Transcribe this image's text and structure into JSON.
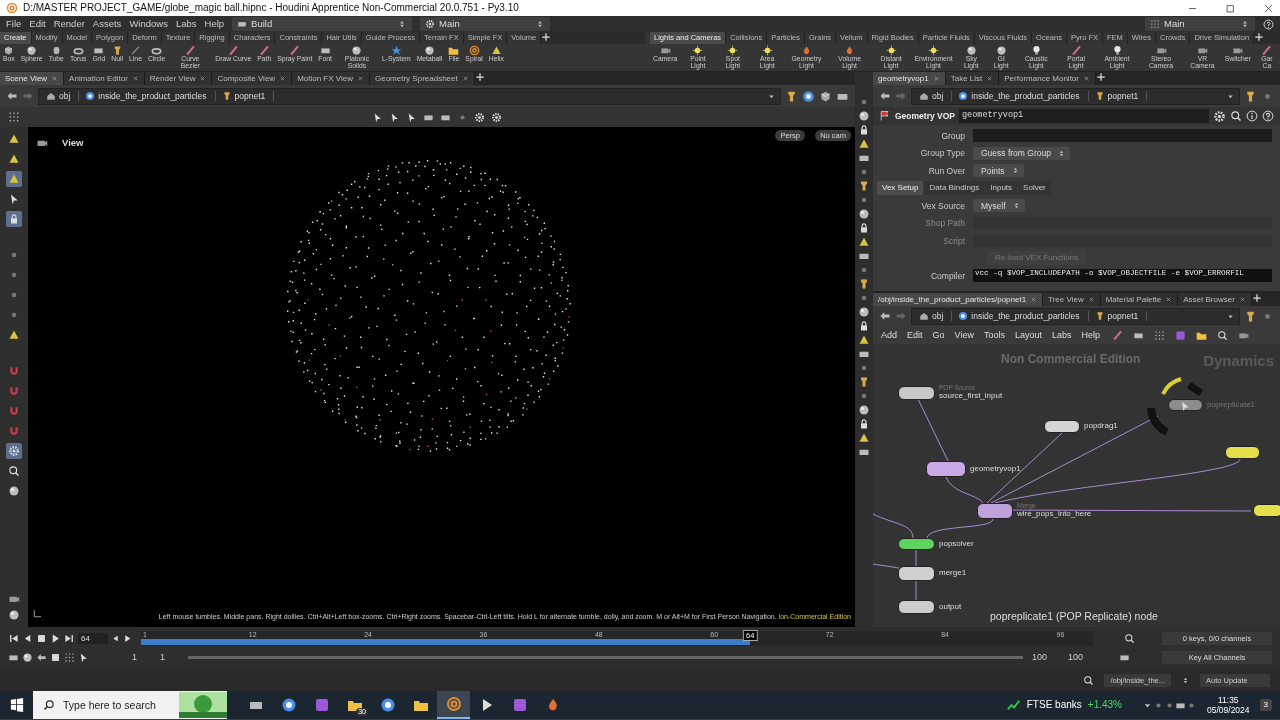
{
  "window": {
    "title": "D:/MASTER PROJECT_GAME/globe_magic ball.hipnc - Houdini Apprentice Non-Commercial 20.0.751 - Py3.10"
  },
  "menu_bar": {
    "items": [
      "File",
      "Edit",
      "Render",
      "Assets",
      "Windows",
      "Labs",
      "Help"
    ],
    "desktop": "Build",
    "context": "Main",
    "right_context": "Main"
  },
  "shelf_left": {
    "tabs": [
      {
        "label": "Create",
        "selected": true
      },
      {
        "label": "Modify",
        "selected": false
      },
      {
        "label": "Model",
        "selected": false
      },
      {
        "label": "Polygon",
        "selected": false
      },
      {
        "label": "Deform",
        "selected": false
      },
      {
        "label": "Texture",
        "selected": false
      },
      {
        "label": "Rigging",
        "selected": false
      },
      {
        "label": "Characters",
        "selected": false
      },
      {
        "label": "Constraints",
        "selected": false
      },
      {
        "label": "Hair Utils",
        "selected": false
      },
      {
        "label": "Guide Process",
        "selected": false
      },
      {
        "label": "Terrain FX",
        "selected": false
      },
      {
        "label": "Simple FX",
        "selected": false
      },
      {
        "label": "Volume",
        "selected": false
      }
    ],
    "tools": [
      "Box",
      "Sphere",
      "Tube",
      "Torus",
      "Grid",
      "Null",
      "Line",
      "Circle",
      "Curve Bezier",
      "Draw Curve",
      "Path",
      "Spray Paint",
      "Font",
      "Platonic Solids",
      "L-System",
      "Metaball",
      "File",
      "Spiral",
      "Helix"
    ]
  },
  "shelf_right": {
    "tabs": [
      {
        "label": "Lights and Cameras",
        "selected": true
      },
      {
        "label": "Collisions",
        "selected": false
      },
      {
        "label": "Particles",
        "selected": false
      },
      {
        "label": "Grains",
        "selected": false
      },
      {
        "label": "Vellum",
        "selected": false
      },
      {
        "label": "Rigid Bodies",
        "selected": false
      },
      {
        "label": "Particle Fluids",
        "selected": false
      },
      {
        "label": "Viscous Fluids",
        "selected": false
      },
      {
        "label": "Oceans",
        "selected": false
      },
      {
        "label": "Pyro FX",
        "selected": false
      },
      {
        "label": "FEM",
        "selected": false
      },
      {
        "label": "Wires",
        "selected": false
      },
      {
        "label": "Crowds",
        "selected": false
      },
      {
        "label": "Drive Simulation",
        "selected": false
      }
    ],
    "tools": [
      "Camera",
      "Point Light",
      "Spot Light",
      "Area Light",
      "Geometry Light",
      "Volume Light",
      "Distant Light",
      "Environment Light",
      "Sky Light",
      "GI Light",
      "Caustic Light",
      "Portal Light",
      "Ambient Light",
      "Stereo Camera",
      "VR Camera",
      "Switcher",
      "Gar Ca"
    ]
  },
  "scene_pane": {
    "tabs": [
      {
        "label": "Scene View",
        "selected": true
      },
      {
        "label": "Animation Editor",
        "selected": false
      },
      {
        "label": "Render View",
        "selected": false
      },
      {
        "label": "Composite View",
        "selected": false
      },
      {
        "label": "Motion FX View",
        "selected": false
      },
      {
        "label": "Geometry Spreadsheet",
        "selected": false
      }
    ],
    "path": [
      "obj",
      "inside_the_product_particles",
      "popnet1"
    ],
    "viewport_tools": [
      {
        "active": false
      },
      {
        "active": false
      },
      {
        "active": true
      },
      {
        "active": false
      },
      {
        "active": true
      },
      {
        "active": false
      },
      {
        "active": false
      },
      {
        "active": false
      },
      {
        "active": false
      },
      {
        "active": false
      },
      {
        "active": false
      },
      {
        "active": false
      },
      {
        "active": false
      },
      {
        "active": false
      },
      {
        "active": true
      },
      {
        "active": false
      },
      {
        "active": false
      }
    ],
    "viewport": {
      "label": "View",
      "view_menu": "Persp",
      "camera_menu": "No cam",
      "hint": "Left mouse tumbles. Middle pans. Right dollies. Ctrl+Alt+Left box-zooms. Ctrl+Right zooms. Spacebar-Ctrl-Left tilts. Hold L for alternate tumble, dolly, and zoom. M or Alt+M for First Person Navigation.",
      "edition": "ion-Commercial Edition"
    }
  },
  "parameter_pane": {
    "tabs": [
      {
        "label": "geometryvop1",
        "selected": true
      },
      {
        "label": "Take List",
        "selected": false
      },
      {
        "label": "Performance Monitor",
        "selected": false
      }
    ],
    "path": [
      "obj",
      "inside_the_product_particles",
      "popnet1"
    ],
    "node_type": "Geometry VOP",
    "node_name": "geometryvop1",
    "rows": [
      {
        "kind": "field",
        "label": "Group",
        "disabled": false
      },
      {
        "kind": "menu",
        "label": "Group Type",
        "value": "Guess from Group",
        "disabled": false
      },
      {
        "kind": "menu",
        "label": "Run Over",
        "value": "Points",
        "disabled": false
      },
      {
        "kind": "tabs",
        "tabs": [
          {
            "label": "Vex Setup",
            "selected": true
          },
          {
            "label": "Data Bindings",
            "selected": false
          },
          {
            "label": "Inputs",
            "selected": false
          },
          {
            "label": "Solver",
            "selected": false
          }
        ]
      },
      {
        "kind": "menu",
        "label": "Vex Source",
        "value": "Myself",
        "disabled": false
      },
      {
        "kind": "field",
        "label": "Shop Path",
        "disabled": true
      },
      {
        "kind": "field",
        "label": "Script",
        "disabled": true
      },
      {
        "kind": "button",
        "label": "Re-load VEX Functions",
        "disabled": true
      },
      {
        "kind": "field",
        "label": "Compiler",
        "value": "vcc -q $VOP_INCLUDEPATH -o $VOP_OBJECTFILE -e $VOP_ERRORFIL",
        "disabled": false
      }
    ]
  },
  "network_pane": {
    "tabs": [
      {
        "label": "/obj/inside_the_product_particles/popnet1",
        "selected": true
      },
      {
        "label": "Tree View",
        "selected": false
      },
      {
        "label": "Material Palette",
        "selected": false
      },
      {
        "label": "Asset Browser",
        "selected": false
      }
    ],
    "path": [
      "obj",
      "inside_the_product_particles",
      "popnet1"
    ],
    "menu": [
      "Add",
      "Edit",
      "Go",
      "View",
      "Tools",
      "Layout",
      "Labs",
      "Help"
    ],
    "watermark": "Non Commercial Edition",
    "context_label": "Dynamics",
    "nodes": [
      {
        "name": "source_first_input",
        "type_label": "POP Source",
        "color": "#c8c8c8"
      },
      {
        "name": "popdrag1",
        "color": "#d4d4d4"
      },
      {
        "name": "geometryvop1",
        "color": "#c9a8e6"
      },
      {
        "name": "wire_pops_into_here",
        "type_label": "Merge",
        "color": "#bfa2dc"
      },
      {
        "name": "popsolver",
        "color": "#5fd35f"
      },
      {
        "name": "merge1",
        "color": "#d0d0d0"
      },
      {
        "name": "output",
        "color": "#cccccc"
      },
      {
        "name": "popreplicate1",
        "color": "#8c8c8c"
      },
      {
        "color": "#e4df4a"
      },
      {
        "color": "#e4df4a"
      }
    ],
    "status": "popreplicate1 (POP Replicate) node"
  },
  "timeline": {
    "frame": "64",
    "ticks": [
      "1",
      "12",
      "24",
      "36",
      "48",
      "60",
      "72",
      "84",
      "96"
    ],
    "level": 0.64,
    "marker": "64",
    "range_start": [
      "1",
      "1"
    ],
    "range_end": [
      "100",
      "100"
    ],
    "keys": "0 keys, 0/0 channels",
    "key_all": "Key All Channels"
  },
  "status_bar": {
    "path_menu": "/obj/inside_the...",
    "auto_update": "Auto Update"
  },
  "taskbar": {
    "search_placeholder": "Type here to search",
    "apps": [
      {
        "selected": false
      },
      {
        "selected": false
      },
      {
        "selected": false
      },
      {
        "selected": false,
        "badge": "30"
      },
      {
        "selected": false
      },
      {
        "selected": false
      },
      {
        "selected": true
      },
      {
        "selected": false
      },
      {
        "selected": false
      },
      {
        "selected": false
      }
    ],
    "widget_name": "FTSE banks",
    "widget_change": "+1.43%",
    "time": "11:35",
    "date": "05/09/2024",
    "notifications": "3"
  }
}
